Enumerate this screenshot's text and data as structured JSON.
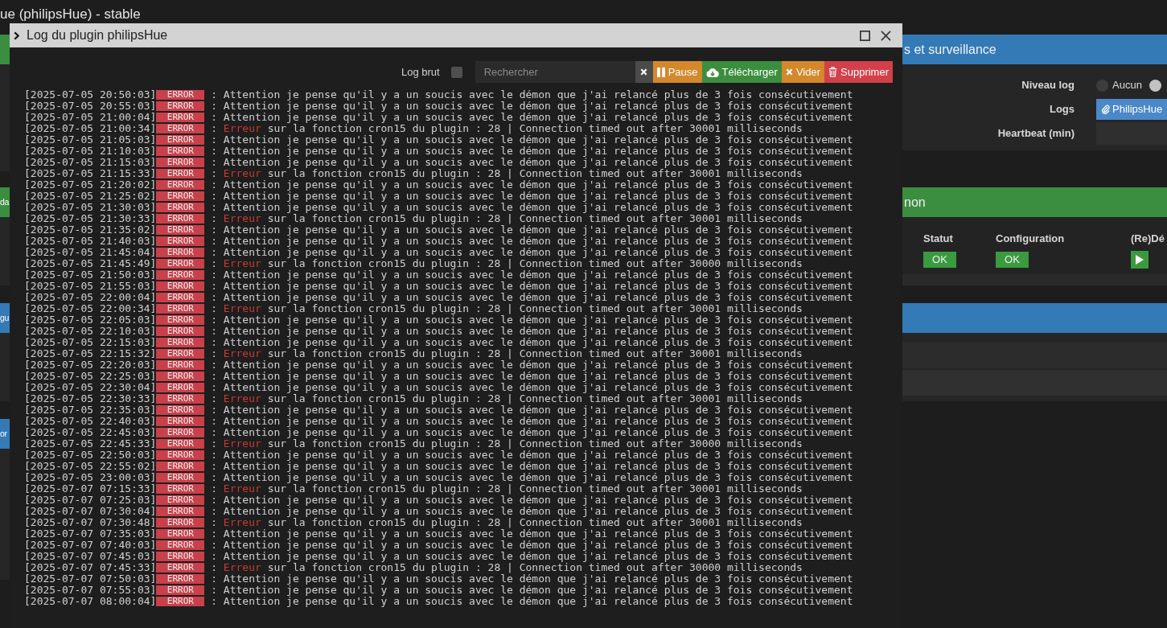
{
  "page": {
    "title": "ue (philipsHue) - stable"
  },
  "left_panels": [
    {
      "color": "#3b8d40"
    },
    {
      "label": "da",
      "color": "#3b8d40"
    },
    {
      "label": "gu",
      "color": "#337ab7"
    },
    {
      "label": "or",
      "color": "#337ab7"
    }
  ],
  "panels": [
    {
      "kind": "form",
      "title": "s et surveillance",
      "color": "#337ab7",
      "fields": [
        {
          "label": "Niveau log",
          "kind": "radios",
          "options": [
            {
              "label": "Aucun",
              "selected": false
            },
            {
              "selected": true
            }
          ]
        },
        {
          "label": "Logs",
          "kind": "button",
          "value": "PhilipsHue"
        },
        {
          "label": "Heartbeat (min)",
          "kind": "input"
        }
      ]
    },
    {
      "kind": "table",
      "title": "non",
      "color": "#3b8d40",
      "table": {
        "columns": [
          "Statut",
          "Configuration",
          "(Re)Dé"
        ],
        "rows": [
          [
            {
              "kind": "badge",
              "text": "OK"
            },
            {
              "kind": "badge",
              "text": "OK"
            },
            {
              "kind": "play"
            }
          ]
        ]
      }
    },
    {
      "kind": "list",
      "color": "#337ab7"
    }
  ],
  "dialog": {
    "title": "Log du plugin philipsHue",
    "toolbar": {
      "raw_label": "Log brut",
      "raw_checked": false,
      "search_placeholder": "Rechercher",
      "buttons": [
        {
          "kind": "pause",
          "label": "Pause"
        },
        {
          "kind": "download",
          "label": "Télécharger"
        },
        {
          "kind": "empty",
          "label": "Vider"
        },
        {
          "kind": "delete",
          "label": "Supprimer"
        }
      ]
    },
    "log": [
      {
        "time": "[2025-07-05 20:50:03]",
        "level": "ERROR",
        "sep": ":",
        "message": "Attention je pense qu'il y a un soucis avec le démon que j'ai relancé plus de 3 fois consécutivement"
      },
      {
        "time": "[2025-07-05 20:55:03]",
        "level": "ERROR",
        "sep": ":",
        "message": "Attention je pense qu'il y a un soucis avec le démon que j'ai relancé plus de 3 fois consécutivement"
      },
      {
        "time": "[2025-07-05 21:00:04]",
        "level": "ERROR",
        "sep": ":",
        "message": "Attention je pense qu'il y a un soucis avec le démon que j'ai relancé plus de 3 fois consécutivement"
      },
      {
        "time": "[2025-07-05 21:00:34]",
        "level": "ERROR",
        "sep": ":",
        "keyword": "Erreur",
        "message": "sur la fonction cron15 du plugin : 28 | Connection timed out after 30001 milliseconds"
      },
      {
        "time": "[2025-07-05 21:05:03]",
        "level": "ERROR",
        "sep": ":",
        "message": "Attention je pense qu'il y a un soucis avec le démon que j'ai relancé plus de 3 fois consécutivement"
      },
      {
        "time": "[2025-07-05 21:10:03]",
        "level": "ERROR",
        "sep": ":",
        "message": "Attention je pense qu'il y a un soucis avec le démon que j'ai relancé plus de 3 fois consécutivement"
      },
      {
        "time": "[2025-07-05 21:15:03]",
        "level": "ERROR",
        "sep": ":",
        "message": "Attention je pense qu'il y a un soucis avec le démon que j'ai relancé plus de 3 fois consécutivement"
      },
      {
        "time": "[2025-07-05 21:15:33]",
        "level": "ERROR",
        "sep": ":",
        "keyword": "Erreur",
        "message": "sur la fonction cron15 du plugin : 28 | Connection timed out after 30001 milliseconds"
      },
      {
        "time": "[2025-07-05 21:20:02]",
        "level": "ERROR",
        "sep": ":",
        "message": "Attention je pense qu'il y a un soucis avec le démon que j'ai relancé plus de 3 fois consécutivement"
      },
      {
        "time": "[2025-07-05 21:25:02]",
        "level": "ERROR",
        "sep": ":",
        "message": "Attention je pense qu'il y a un soucis avec le démon que j'ai relancé plus de 3 fois consécutivement"
      },
      {
        "time": "[2025-07-05 21:30:03]",
        "level": "ERROR",
        "sep": ":",
        "message": "Attention je pense qu'il y a un soucis avec le démon que j'ai relancé plus de 3 fois consécutivement"
      },
      {
        "time": "[2025-07-05 21:30:33]",
        "level": "ERROR",
        "sep": ":",
        "keyword": "Erreur",
        "message": "sur la fonction cron15 du plugin : 28 | Connection timed out after 30001 milliseconds"
      },
      {
        "time": "[2025-07-05 21:35:02]",
        "level": "ERROR",
        "sep": ":",
        "message": "Attention je pense qu'il y a un soucis avec le démon que j'ai relancé plus de 3 fois consécutivement"
      },
      {
        "time": "[2025-07-05 21:40:03]",
        "level": "ERROR",
        "sep": ":",
        "message": "Attention je pense qu'il y a un soucis avec le démon que j'ai relancé plus de 3 fois consécutivement"
      },
      {
        "time": "[2025-07-05 21:45:04]",
        "level": "ERROR",
        "sep": ":",
        "message": "Attention je pense qu'il y a un soucis avec le démon que j'ai relancé plus de 3 fois consécutivement"
      },
      {
        "time": "[2025-07-05 21:45:49]",
        "level": "ERROR",
        "sep": ":",
        "keyword": "Erreur",
        "message": "sur la fonction cron15 du plugin : 28 | Connection timed out after 30000 milliseconds"
      },
      {
        "time": "[2025-07-05 21:50:03]",
        "level": "ERROR",
        "sep": ":",
        "message": "Attention je pense qu'il y a un soucis avec le démon que j'ai relancé plus de 3 fois consécutivement"
      },
      {
        "time": "[2025-07-05 21:55:03]",
        "level": "ERROR",
        "sep": ":",
        "message": "Attention je pense qu'il y a un soucis avec le démon que j'ai relancé plus de 3 fois consécutivement"
      },
      {
        "time": "[2025-07-05 22:00:04]",
        "level": "ERROR",
        "sep": ":",
        "message": "Attention je pense qu'il y a un soucis avec le démon que j'ai relancé plus de 3 fois consécutivement"
      },
      {
        "time": "[2025-07-05 22:00:34]",
        "level": "ERROR",
        "sep": ":",
        "keyword": "Erreur",
        "message": "sur la fonction cron15 du plugin : 28 | Connection timed out after 30001 milliseconds"
      },
      {
        "time": "[2025-07-05 22:05:03]",
        "level": "ERROR",
        "sep": ":",
        "message": "Attention je pense qu'il y a un soucis avec le démon que j'ai relancé plus de 3 fois consécutivement"
      },
      {
        "time": "[2025-07-05 22:10:03]",
        "level": "ERROR",
        "sep": ":",
        "message": "Attention je pense qu'il y a un soucis avec le démon que j'ai relancé plus de 3 fois consécutivement"
      },
      {
        "time": "[2025-07-05 22:15:03]",
        "level": "ERROR",
        "sep": ":",
        "message": "Attention je pense qu'il y a un soucis avec le démon que j'ai relancé plus de 3 fois consécutivement"
      },
      {
        "time": "[2025-07-05 22:15:32]",
        "level": "ERROR",
        "sep": ":",
        "keyword": "Erreur",
        "message": "sur la fonction cron15 du plugin : 28 | Connection timed out after 30001 milliseconds"
      },
      {
        "time": "[2025-07-05 22:20:03]",
        "level": "ERROR",
        "sep": ":",
        "message": "Attention je pense qu'il y a un soucis avec le démon que j'ai relancé plus de 3 fois consécutivement"
      },
      {
        "time": "[2025-07-05 22:25:03]",
        "level": "ERROR",
        "sep": ":",
        "message": "Attention je pense qu'il y a un soucis avec le démon que j'ai relancé plus de 3 fois consécutivement"
      },
      {
        "time": "[2025-07-05 22:30:04]",
        "level": "ERROR",
        "sep": ":",
        "message": "Attention je pense qu'il y a un soucis avec le démon que j'ai relancé plus de 3 fois consécutivement"
      },
      {
        "time": "[2025-07-05 22:30:33]",
        "level": "ERROR",
        "sep": ":",
        "keyword": "Erreur",
        "message": "sur la fonction cron15 du plugin : 28 | Connection timed out after 30001 milliseconds"
      },
      {
        "time": "[2025-07-05 22:35:03]",
        "level": "ERROR",
        "sep": ":",
        "message": "Attention je pense qu'il y a un soucis avec le démon que j'ai relancé plus de 3 fois consécutivement"
      },
      {
        "time": "[2025-07-05 22:40:03]",
        "level": "ERROR",
        "sep": ":",
        "message": "Attention je pense qu'il y a un soucis avec le démon que j'ai relancé plus de 3 fois consécutivement"
      },
      {
        "time": "[2025-07-05 22:45:03]",
        "level": "ERROR",
        "sep": ":",
        "message": "Attention je pense qu'il y a un soucis avec le démon que j'ai relancé plus de 3 fois consécutivement"
      },
      {
        "time": "[2025-07-05 22:45:33]",
        "level": "ERROR",
        "sep": ":",
        "keyword": "Erreur",
        "message": "sur la fonction cron15 du plugin : 28 | Connection timed out after 30000 milliseconds"
      },
      {
        "time": "[2025-07-05 22:50:03]",
        "level": "ERROR",
        "sep": ":",
        "message": "Attention je pense qu'il y a un soucis avec le démon que j'ai relancé plus de 3 fois consécutivement"
      },
      {
        "time": "[2025-07-05 22:55:02]",
        "level": "ERROR",
        "sep": ":",
        "message": "Attention je pense qu'il y a un soucis avec le démon que j'ai relancé plus de 3 fois consécutivement"
      },
      {
        "time": "[2025-07-05 23:00:03]",
        "level": "ERROR",
        "sep": ":",
        "message": "Attention je pense qu'il y a un soucis avec le démon que j'ai relancé plus de 3 fois consécutivement"
      },
      {
        "time": "[2025-07-07 07:15:33]",
        "level": "ERROR",
        "sep": ":",
        "keyword": "Erreur",
        "message": "sur la fonction cron15 du plugin : 28 | Connection timed out after 30001 milliseconds"
      },
      {
        "time": "[2025-07-07 07:25:03]",
        "level": "ERROR",
        "sep": ":",
        "message": "Attention je pense qu'il y a un soucis avec le démon que j'ai relancé plus de 3 fois consécutivement"
      },
      {
        "time": "[2025-07-07 07:30:04]",
        "level": "ERROR",
        "sep": ":",
        "message": "Attention je pense qu'il y a un soucis avec le démon que j'ai relancé plus de 3 fois consécutivement"
      },
      {
        "time": "[2025-07-07 07:30:48]",
        "level": "ERROR",
        "sep": ":",
        "keyword": "Erreur",
        "message": "sur la fonction cron15 du plugin : 28 | Connection timed out after 30001 milliseconds"
      },
      {
        "time": "[2025-07-07 07:35:03]",
        "level": "ERROR",
        "sep": ":",
        "message": "Attention je pense qu'il y a un soucis avec le démon que j'ai relancé plus de 3 fois consécutivement"
      },
      {
        "time": "[2025-07-07 07:40:03]",
        "level": "ERROR",
        "sep": ":",
        "message": "Attention je pense qu'il y a un soucis avec le démon que j'ai relancé plus de 3 fois consécutivement"
      },
      {
        "time": "[2025-07-07 07:45:03]",
        "level": "ERROR",
        "sep": ":",
        "message": "Attention je pense qu'il y a un soucis avec le démon que j'ai relancé plus de 3 fois consécutivement"
      },
      {
        "time": "[2025-07-07 07:45:33]",
        "level": "ERROR",
        "sep": ":",
        "keyword": "Erreur",
        "message": "sur la fonction cron15 du plugin : 28 | Connection timed out after 30000 milliseconds"
      },
      {
        "time": "[2025-07-07 07:50:03]",
        "level": "ERROR",
        "sep": ":",
        "message": "Attention je pense qu'il y a un soucis avec le démon que j'ai relancé plus de 3 fois consécutivement"
      },
      {
        "time": "[2025-07-07 07:55:03]",
        "level": "ERROR",
        "sep": ":",
        "message": "Attention je pense qu'il y a un soucis avec le démon que j'ai relancé plus de 3 fois consécutivement"
      },
      {
        "time": "[2025-07-07 08:00:04]",
        "level": "ERROR",
        "sep": ":",
        "message": "Attention je pense qu'il y a un soucis avec le démon que j'ai relancé plus de 3 fois consécutivement"
      }
    ]
  }
}
